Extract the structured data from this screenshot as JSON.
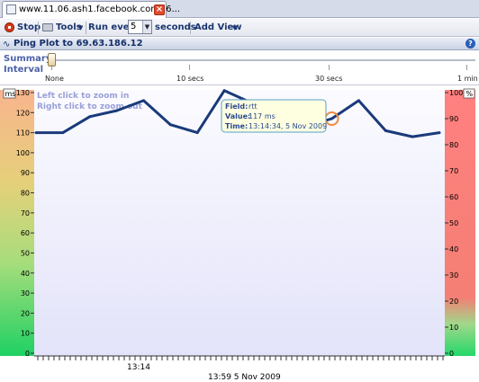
{
  "tab": {
    "title": "www.11.06.ash1.facebook.com (6...",
    "close_label": "×"
  },
  "toolbar": {
    "stop_label": "Stop",
    "tools_label": "Tools",
    "run_every_label": "Run every",
    "interval_value": "5",
    "seconds_label": "seconds",
    "add_view_label": "Add View"
  },
  "panel": {
    "title": "Ping Plot to 69.63.186.12",
    "help_label": "?"
  },
  "summary": {
    "label_line1": "Summary",
    "label_line2": "Interval",
    "ticks": [
      "None",
      "10 secs",
      "30 secs",
      "1 min"
    ],
    "value": "None"
  },
  "plot": {
    "left_unit": "ms",
    "right_unit": "%",
    "zoom_hint_1": "Left click to zoom in",
    "zoom_hint_2": "Right click to zoom out",
    "time_label": "13:14",
    "date_label": "13:59 5 Nov 2009",
    "tooltip": {
      "field_label": "Field:",
      "field_value": "rtt",
      "value_label": "Value:",
      "value_value": "117 ms",
      "time_label": "Time:",
      "time_value": "13:14:34, 5 Nov 2009"
    },
    "colors": {
      "line": "#1a3a7a",
      "marker": "#f08a3a",
      "bg": "#f7f7ff"
    }
  },
  "chart_data": {
    "type": "line",
    "series": [
      {
        "field": "rtt",
        "values": [
          110,
          110,
          118,
          121,
          126,
          114,
          110,
          131,
          125,
          111,
          113,
          117,
          126,
          111,
          108,
          110
        ]
      }
    ],
    "highlight_index": 11,
    "y_left": {
      "label": "ms",
      "ylim": [
        0,
        130
      ],
      "ticks": [
        0,
        10,
        20,
        30,
        40,
        50,
        60,
        70,
        80,
        90,
        100,
        110,
        120,
        130
      ]
    },
    "y_right": {
      "label": "%",
      "ylim": [
        0,
        100
      ],
      "ticks": [
        0,
        10,
        20,
        30,
        40,
        50,
        60,
        70,
        80,
        90,
        100
      ]
    },
    "x_label": "13:14",
    "date": "13:59 5 Nov 2009"
  }
}
